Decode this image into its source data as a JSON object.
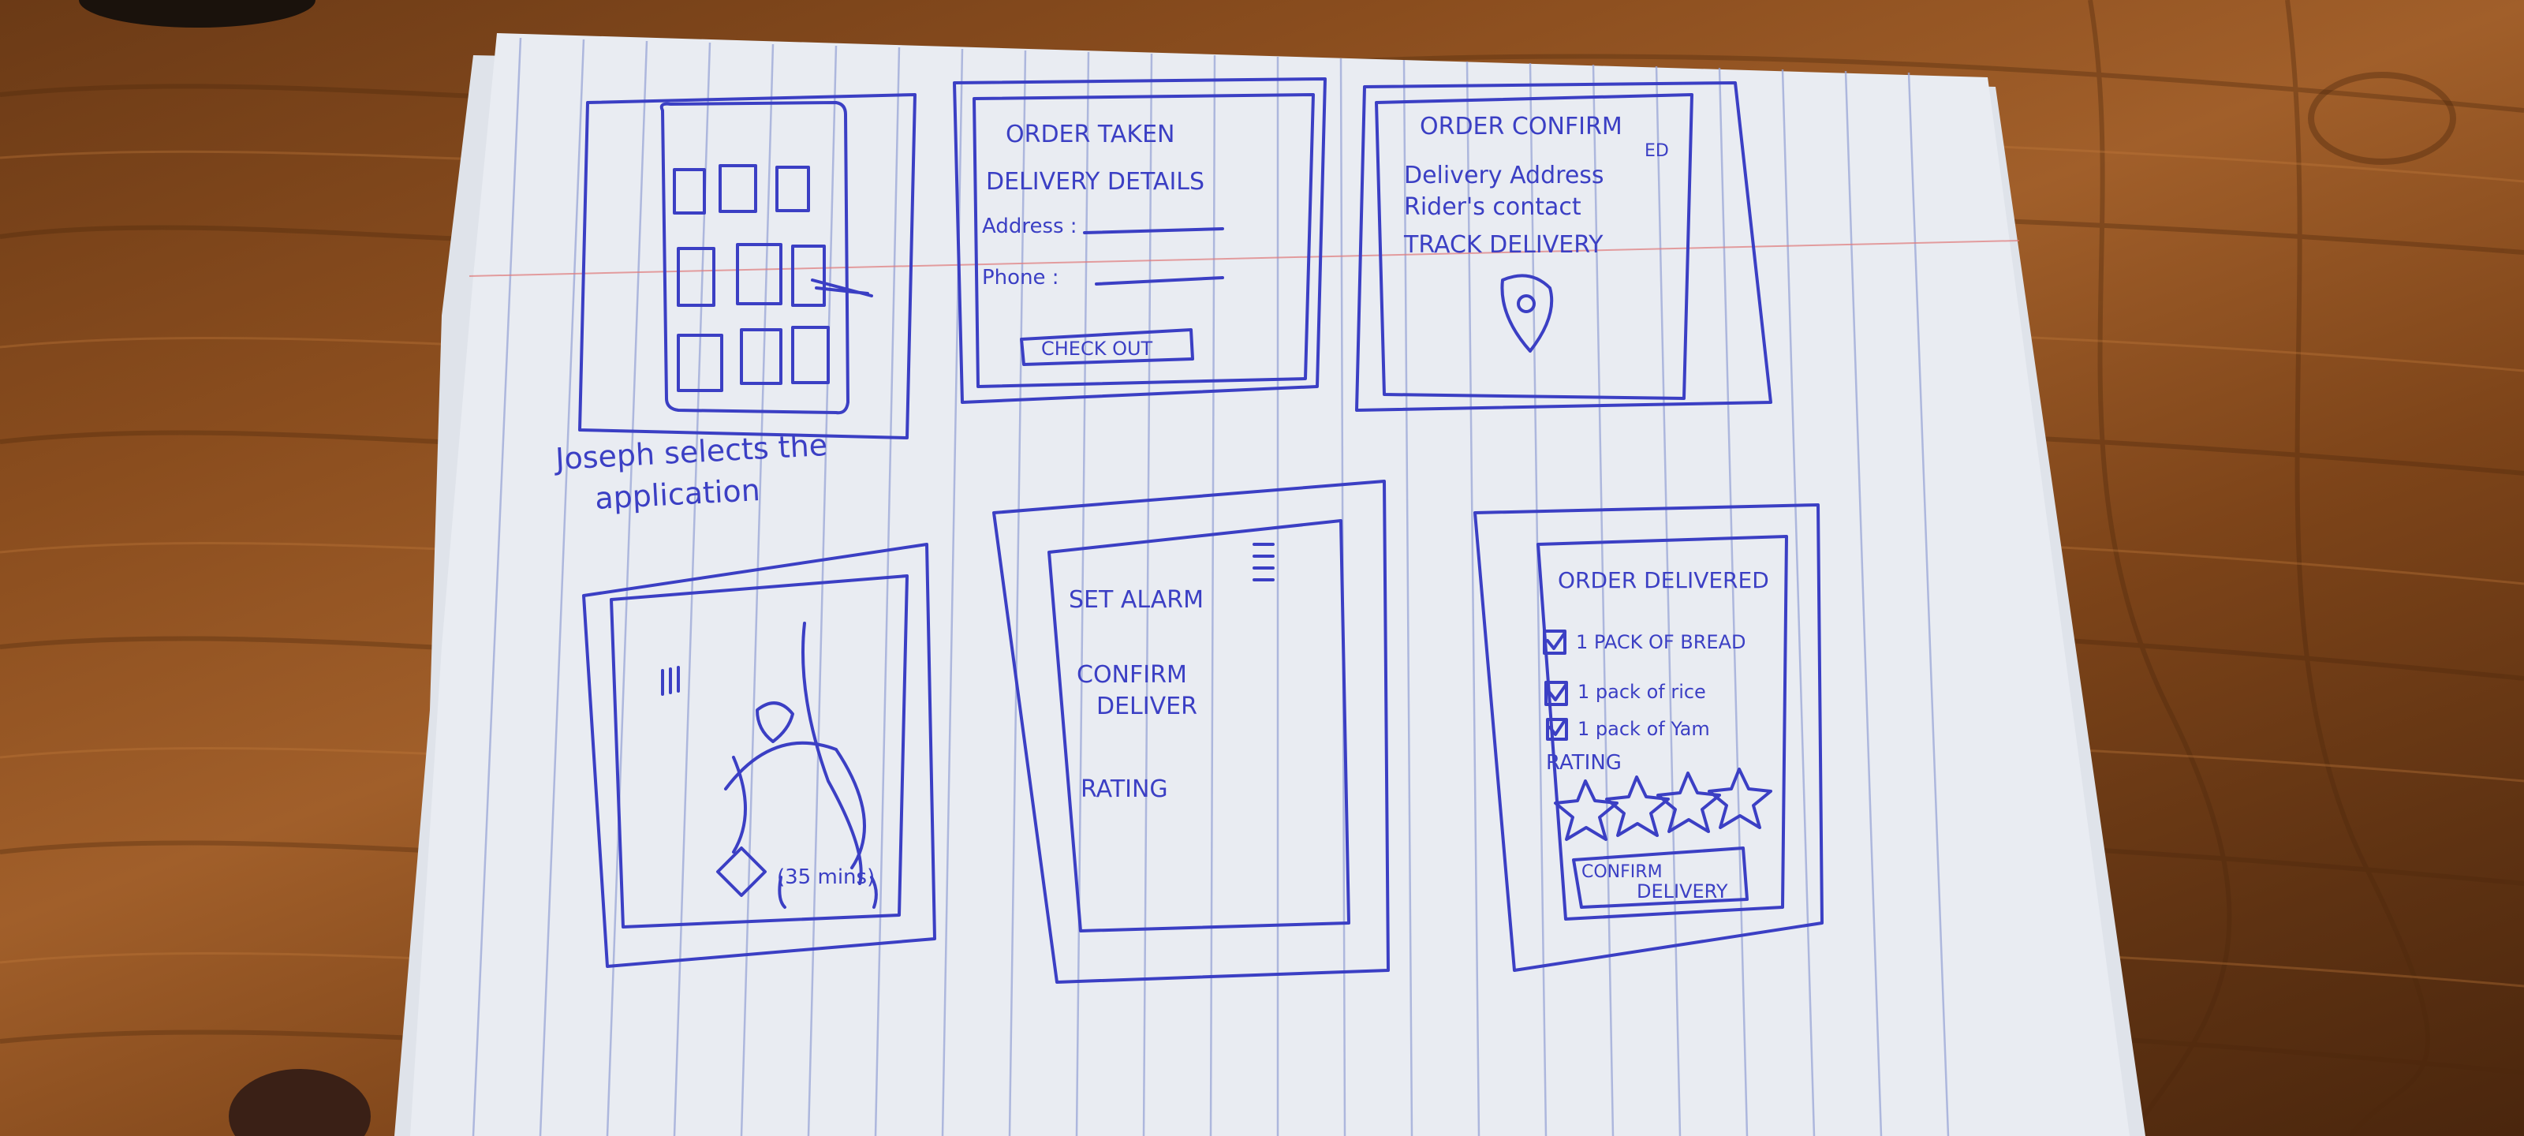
{
  "sketches": [
    {
      "id": "app-grid",
      "caption_line1": "Joseph selects the",
      "caption_line2": "application"
    },
    {
      "id": "order-taken",
      "title": "ORDER TAKEN",
      "section": "DELIVERY DETAILS",
      "address_label": "Address :",
      "phone_label": "Phone :",
      "button_label": "CHECK OUT"
    },
    {
      "id": "order-confirmed",
      "title_line1": "ORDER CONFIRM",
      "title_line2": "ED",
      "line1": "Delivery Address",
      "line2": "Rider's contact",
      "line3": "TRACK DELIVERY"
    },
    {
      "id": "map",
      "eta": "(35 mins)"
    },
    {
      "id": "menu",
      "item1": "SET ALARM",
      "item2_line1": "CONFIRM",
      "item2_line2": "DELIVER",
      "item3": "RATING"
    },
    {
      "id": "order-delivered",
      "title": "ORDER DELIVERED",
      "items": [
        "1 PACK OF BREAD",
        "1 pack of rice",
        "1 pack of Yam"
      ],
      "rating_label": "RATING",
      "button_line1": "CONFIRM",
      "button_line2": "DELIVERY"
    }
  ]
}
